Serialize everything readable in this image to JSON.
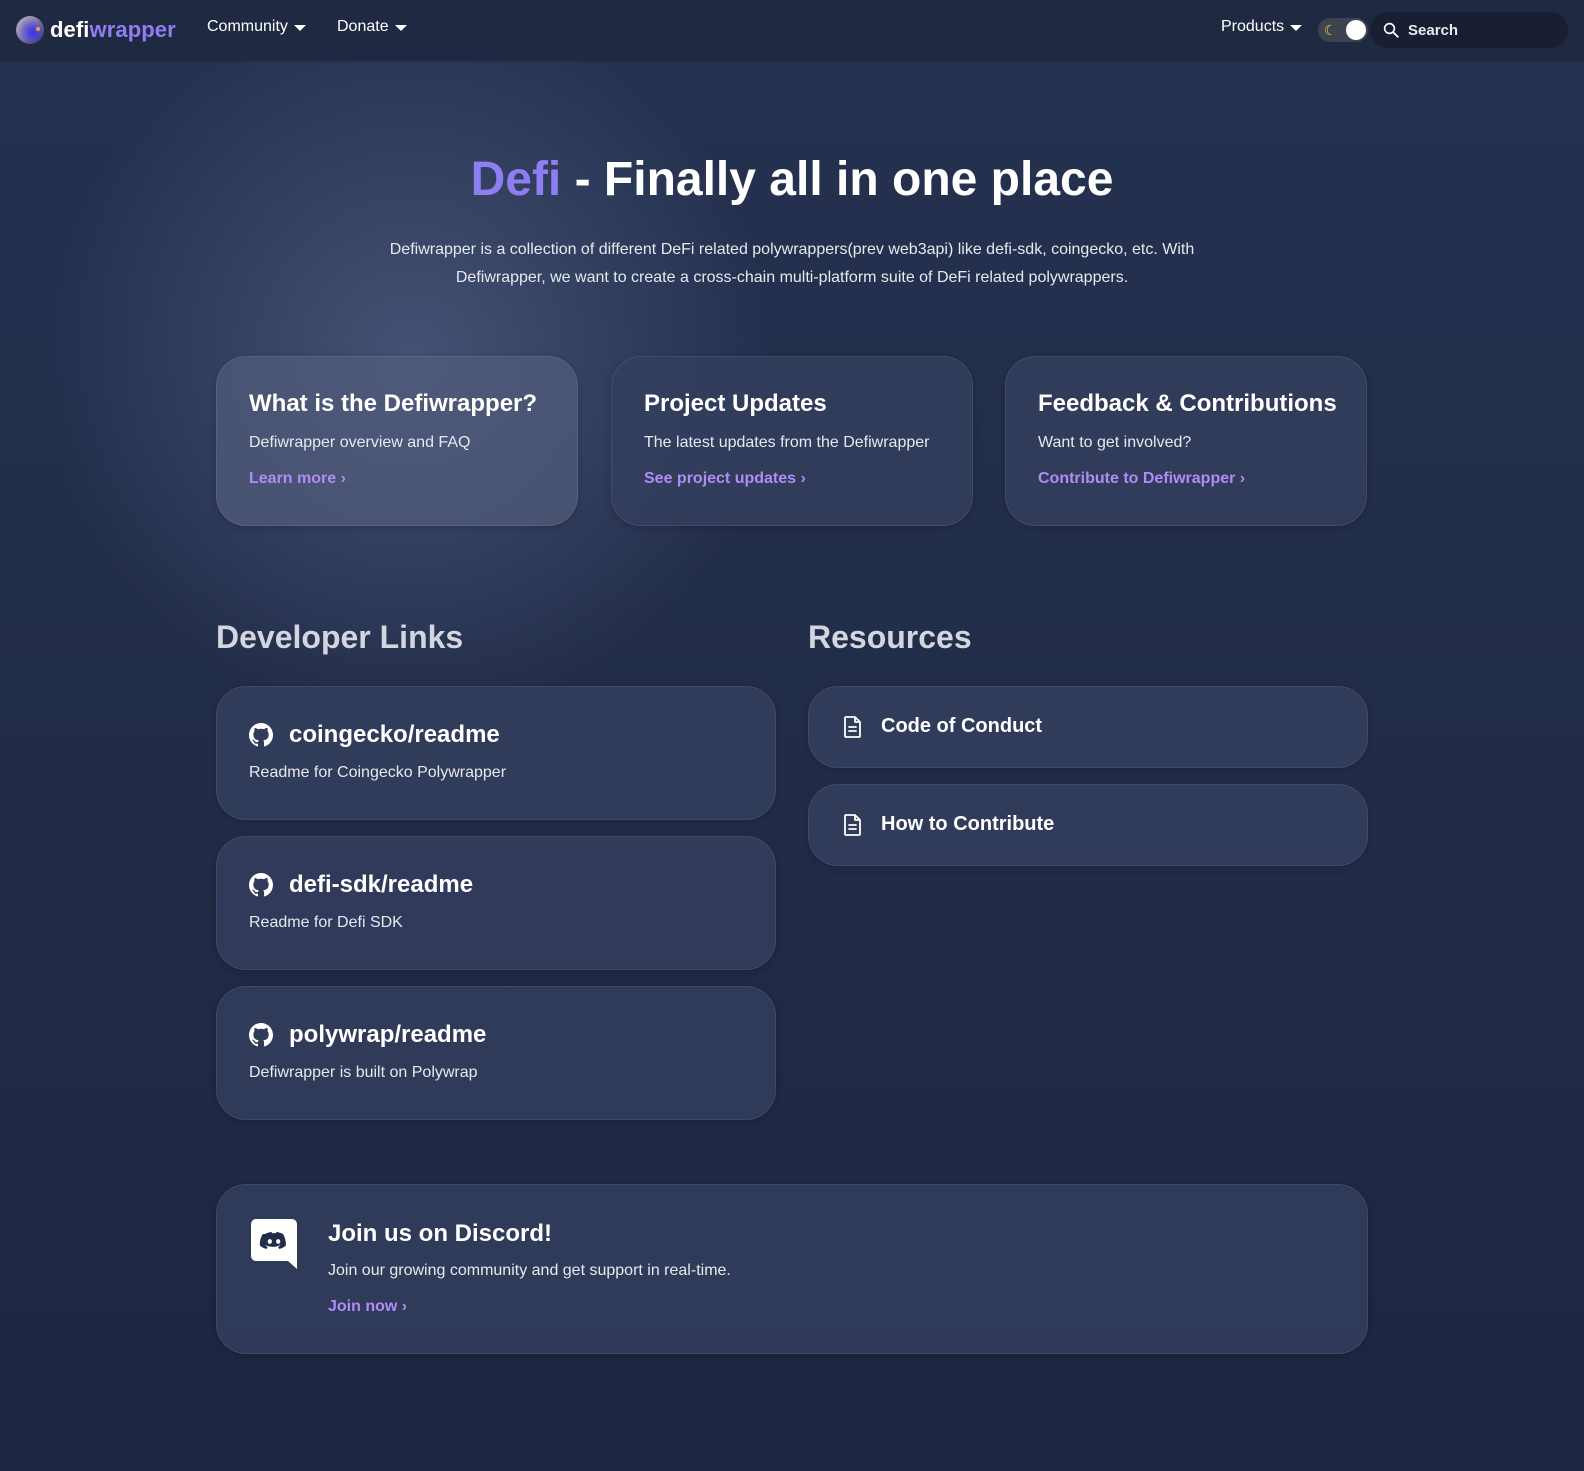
{
  "navbar": {
    "brand": {
      "part1": "defi",
      "part2": "wrapper"
    },
    "items": [
      {
        "label": "Community"
      },
      {
        "label": "Donate"
      }
    ],
    "products_label": "Products",
    "theme_toggle_icon": "moon-icon",
    "search": {
      "placeholder": "Search",
      "icon": "search-icon"
    }
  },
  "hero": {
    "title_accent": "Defi",
    "title_rest": " - Finally all in one place",
    "description": "Defiwrapper is a collection of different DeFi related polywrappers(prev web3api) like defi-sdk, coingecko, etc. With Defiwrapper, we want to create a cross-chain multi-platform suite of DeFi related polywrappers."
  },
  "feature_cards": [
    {
      "title": "What is the Defiwrapper?",
      "description": "Defiwrapper overview and FAQ",
      "link": "Learn more ›"
    },
    {
      "title": "Project Updates",
      "description": "The latest updates from the Defiwrapper",
      "link": "See project updates ›"
    },
    {
      "title": "Feedback & Contributions",
      "description": "Want to get involved?",
      "link": "Contribute to Defiwrapper ›"
    }
  ],
  "developer_links": {
    "heading": "Developer Links",
    "items": [
      {
        "icon": "github-icon",
        "title": "coingecko/readme",
        "description": "Readme for Coingecko Polywrapper"
      },
      {
        "icon": "github-icon",
        "title": "defi-sdk/readme",
        "description": "Readme for Defi SDK"
      },
      {
        "icon": "github-icon",
        "title": "polywrap/readme",
        "description": "Defiwrapper is built on Polywrap"
      }
    ]
  },
  "resources": {
    "heading": "Resources",
    "items": [
      {
        "icon": "document-icon",
        "title": "Code of Conduct"
      },
      {
        "icon": "document-icon",
        "title": "How to Contribute"
      }
    ]
  },
  "discord": {
    "icon": "discord-icon",
    "title": "Join us on Discord!",
    "description": "Join our growing community and get support in real-time.",
    "link": "Join now ›"
  },
  "colors": {
    "accent": "#8f7df2",
    "link": "#b08cf5",
    "navbar_bg": "#1f2941",
    "page_bg": "#222c48"
  }
}
